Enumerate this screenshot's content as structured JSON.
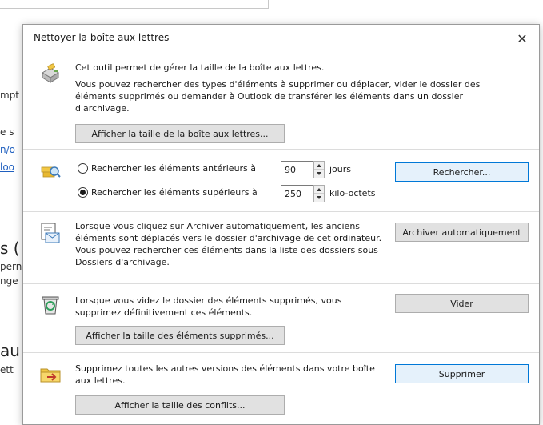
{
  "background": {
    "fragments": [
      "mpt",
      "e s",
      "n/o",
      "loo",
      "s (",
      "pern",
      "nge",
      "au",
      "ett"
    ]
  },
  "dialog": {
    "title": "Nettoyer la boîte aux lettres",
    "close_label": "✕",
    "mailbox": {
      "line1": "Cet outil permet de gérer la taille de la boîte aux lettres.",
      "line2": "Vous pouvez rechercher des types d'éléments à supprimer ou déplacer, vider le dossier des éléments supprimés ou demander à Outlook de transférer les éléments dans un dossier d'archivage.",
      "button": "Afficher la taille de la boîte aux lettres..."
    },
    "search": {
      "older_label": "Rechercher les éléments antérieurs à",
      "older_value": "90",
      "older_unit": "jours",
      "larger_label": "Rechercher les éléments supérieurs à",
      "larger_value": "250",
      "larger_unit": "kilo-octets",
      "selected": "larger",
      "button": "Rechercher..."
    },
    "archive": {
      "text": "Lorsque vous cliquez sur Archiver automatiquement, les anciens éléments sont déplacés vers le dossier d'archivage de cet ordinateur. Vous pouvez rechercher ces éléments dans la liste des dossiers sous Dossiers d'archivage.",
      "button": "Archiver automatiquement"
    },
    "deleted": {
      "text": "Lorsque vous videz le dossier des éléments supprimés, vous supprimez définitivement ces éléments.",
      "empty_button": "Vider",
      "size_button": "Afficher la taille des éléments supprimés..."
    },
    "conflicts": {
      "text": "Supprimez toutes les autres versions des éléments dans votre boîte aux lettres.",
      "delete_button": "Supprimer",
      "size_button": "Afficher la taille des conflits..."
    }
  },
  "colors": {
    "accent": "#0078d7",
    "button_bg": "#e1e1e1",
    "link": "#1f5fbf"
  }
}
